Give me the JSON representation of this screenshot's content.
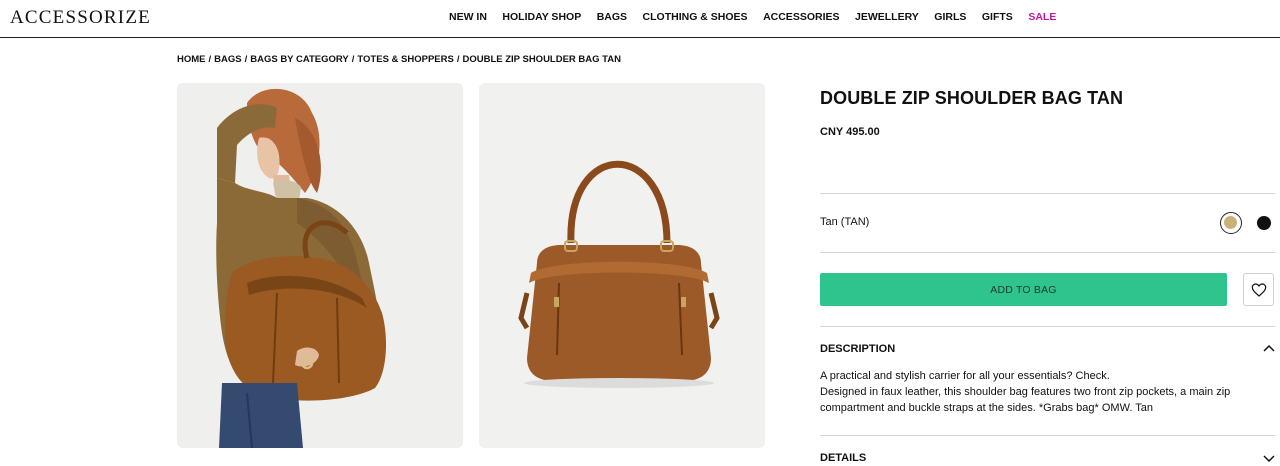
{
  "header": {
    "logo": "ACCESSORIZE",
    "nav": [
      {
        "label": "NEW IN"
      },
      {
        "label": "HOLIDAY SHOP"
      },
      {
        "label": "BAGS"
      },
      {
        "label": "CLOTHING & SHOES"
      },
      {
        "label": "ACCESSORIES"
      },
      {
        "label": "JEWELLERY"
      },
      {
        "label": "GIRLS"
      },
      {
        "label": "GIFTS"
      },
      {
        "label": "SALE"
      }
    ],
    "sale_color": "#c2189a"
  },
  "breadcrumb": [
    "HOME",
    "BAGS",
    "BAGS BY CATEGORY",
    "TOTES & SHOPPERS",
    "DOUBLE ZIP SHOULDER BAG TAN"
  ],
  "breadcrumb_separator": "/",
  "product": {
    "title": "DOUBLE ZIP SHOULDER BAG TAN",
    "price": "CNY 495.00",
    "colour_label": "Tan (TAN)",
    "swatches": [
      {
        "name": "tan",
        "color": "#c9b27a",
        "selected": true
      },
      {
        "name": "black",
        "color": "#111111",
        "selected": false
      }
    ],
    "add_to_bag": "ADD TO BAG",
    "add_button_color": "#2fc48d",
    "description_heading": "DESCRIPTION",
    "description_lines": [
      "A practical and stylish carrier for all your essentials? Check.",
      "Designed in faux leather, this shoulder bag features two front zip pockets, a main zip compartment and buckle straps at the sides. *Grabs bag* OMW. Tan"
    ],
    "details_heading": "DETAILS"
  },
  "icons": {
    "wishlist": "heart-icon",
    "description_toggle": "chevron-up-icon",
    "details_toggle": "chevron-down-icon"
  }
}
